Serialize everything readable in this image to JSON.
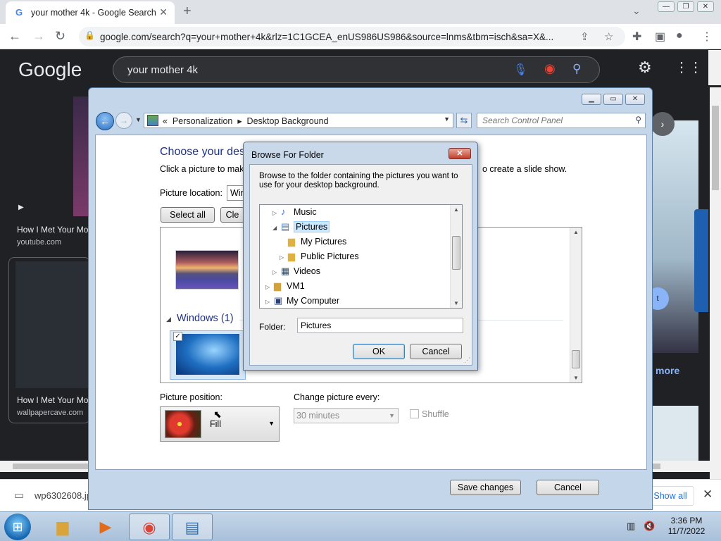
{
  "browser": {
    "tab_title": "your mother 4k - Google Search",
    "tab_favicon": "G",
    "url": "google.com/search?q=your+mother+4k&rlz=1C1GCEA_enUS986US986&source=lnms&tbm=isch&sa=X&..."
  },
  "google": {
    "logo": "Google",
    "query": "your mother 4k",
    "results": [
      {
        "title": "How I Met Your Mo",
        "source": "youtube.com"
      },
      {
        "title": "How I Met Your Mo",
        "source": "wallpapercave.com"
      }
    ],
    "more_label": "more",
    "visit_label": "t"
  },
  "download_bar": {
    "filename": "wp6302608.jp",
    "show_all": "Show all"
  },
  "taskbar": {
    "time": "3:36 PM",
    "date": "11/7/2022"
  },
  "control_panel": {
    "breadcrumb_1": "Personalization",
    "breadcrumb_2": "Desktop Background",
    "search_placeholder": "Search Control Panel",
    "heading": "Choose your desl",
    "description": "Click a picture to make",
    "description_tail": "o create a slide show.",
    "picture_location_label": "Picture location:",
    "picture_location_value": "Win",
    "select_all": "Select all",
    "clear_all": "Cle",
    "group_header": "Windows (1)",
    "picture_position_label": "Picture position:",
    "picture_position_value": "Fill",
    "change_every_label": "Change picture every:",
    "change_every_value": "30 minutes",
    "shuffle_label": "Shuffle",
    "save_changes": "Save changes",
    "cancel": "Cancel"
  },
  "browse_dialog": {
    "title": "Browse For Folder",
    "close_label": "✕",
    "description": "Browse to the folder containing the pictures you want to use for your desktop background.",
    "tree": [
      {
        "label": "Music",
        "icon": "music-icon"
      },
      {
        "label": "Pictures",
        "icon": "pictures-folder-icon",
        "selected": true
      },
      {
        "label": "My Pictures",
        "icon": "folder-icon"
      },
      {
        "label": "Public Pictures",
        "icon": "folder-icon"
      },
      {
        "label": "Videos",
        "icon": "videos-icon"
      },
      {
        "label": "VM1",
        "icon": "user-folder-icon"
      },
      {
        "label": "My Computer",
        "icon": "computer-icon"
      }
    ],
    "folder_label": "Folder:",
    "folder_value": "Pictures",
    "ok": "OK",
    "cancel": "Cancel"
  }
}
